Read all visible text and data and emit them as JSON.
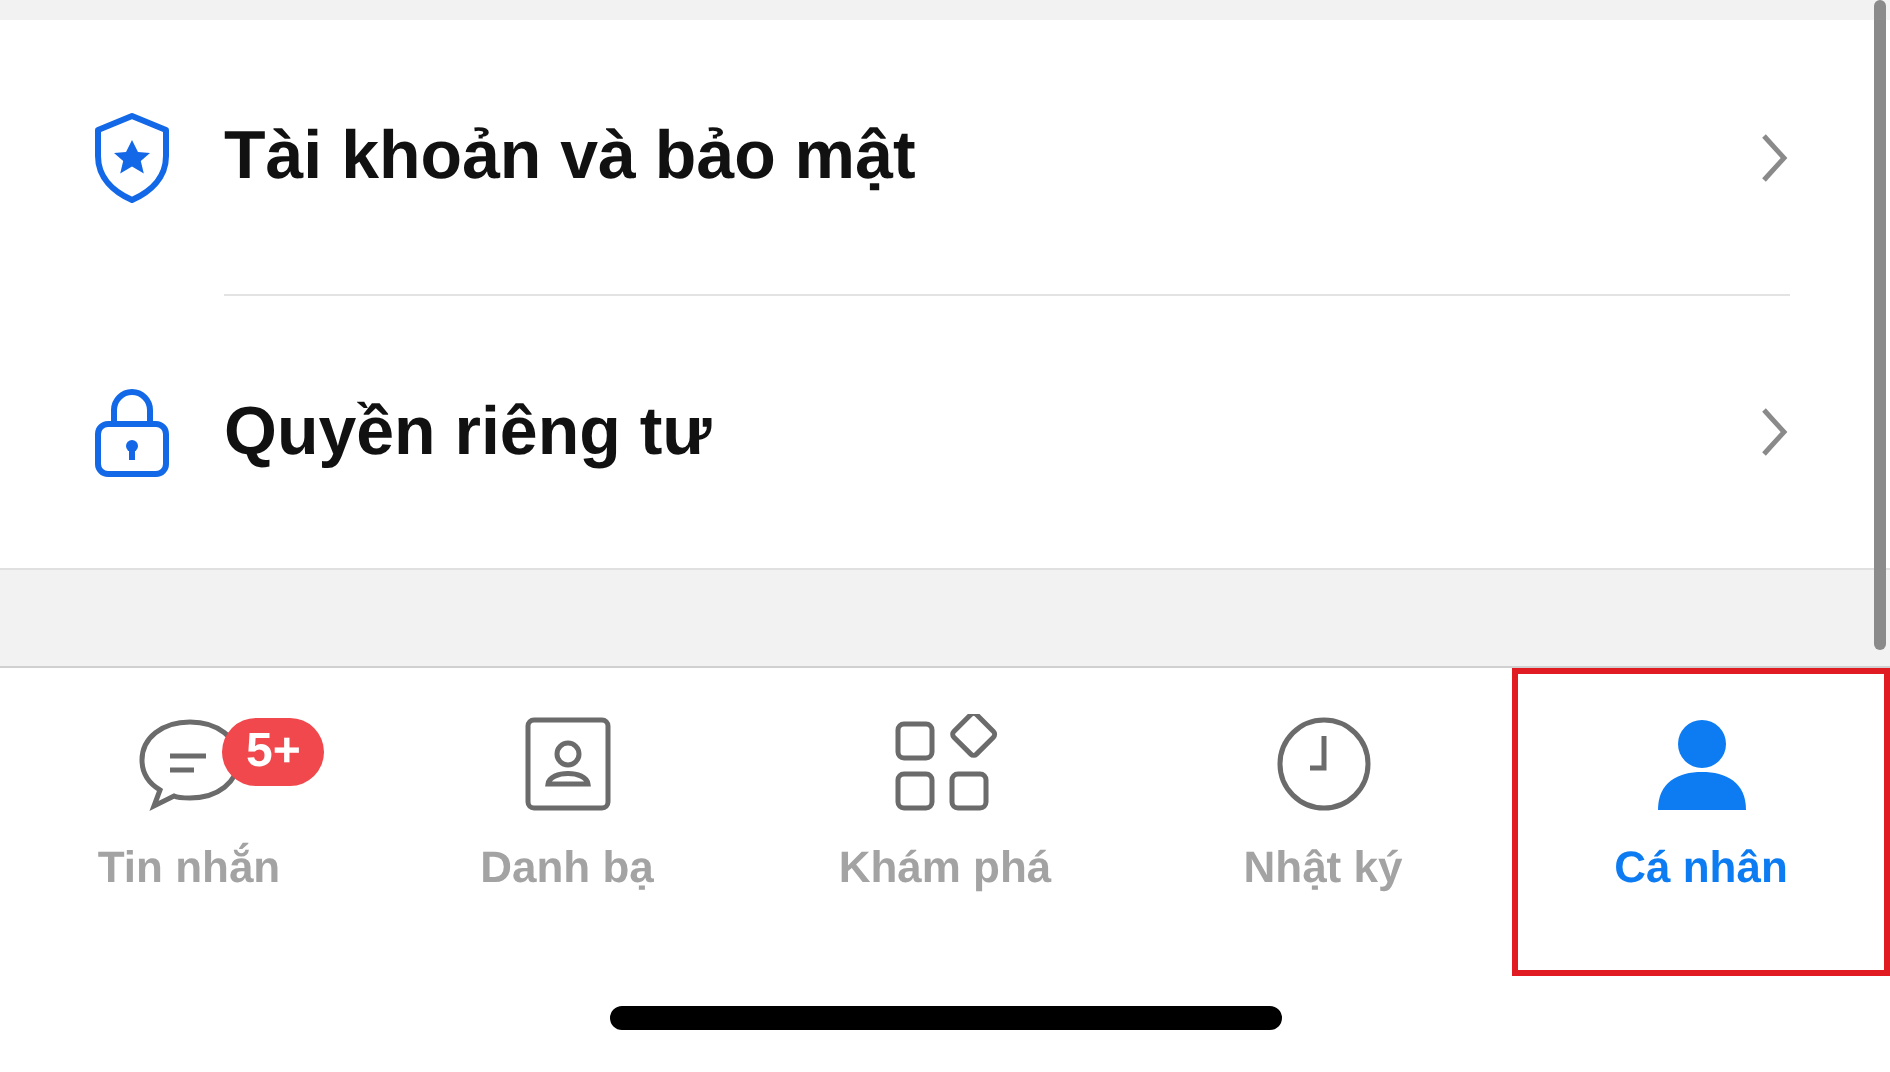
{
  "settings": [
    {
      "kind": "shield",
      "label": "Tài khoản và bảo mật"
    },
    {
      "kind": "lock",
      "label": "Quyền riêng tư"
    }
  ],
  "tab_bar": [
    {
      "kind": "chat",
      "label": "Tin nhắn",
      "badge": "5+",
      "selected": false
    },
    {
      "kind": "contacts",
      "label": "Danh bạ",
      "selected": false
    },
    {
      "kind": "discover",
      "label": "Khám phá",
      "selected": false
    },
    {
      "kind": "clock",
      "label": "Nhật ký",
      "selected": false
    },
    {
      "kind": "person",
      "label": "Cá nhân",
      "selected": true
    }
  ]
}
